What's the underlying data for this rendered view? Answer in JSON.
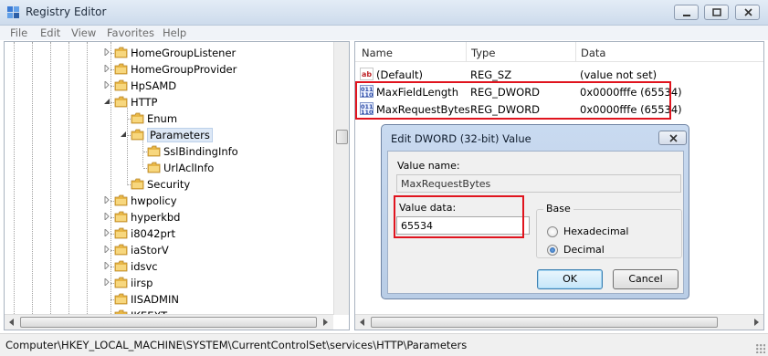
{
  "window": {
    "title": "Registry Editor"
  },
  "menu": [
    "File",
    "Edit",
    "View",
    "Favorites",
    "Help"
  ],
  "tree": {
    "items": [
      {
        "label": "HomeGroupListener",
        "level": 0,
        "expander": "collapsed"
      },
      {
        "label": "HomeGroupProvider",
        "level": 0,
        "expander": "collapsed"
      },
      {
        "label": "HpSAMD",
        "level": 0,
        "expander": "collapsed"
      },
      {
        "label": "HTTP",
        "level": 0,
        "expander": "expanded"
      },
      {
        "label": "Enum",
        "level": 1,
        "expander": "none"
      },
      {
        "label": "Parameters",
        "level": 1,
        "expander": "expanded",
        "selected": true
      },
      {
        "label": "SslBindingInfo",
        "level": 2,
        "expander": "none"
      },
      {
        "label": "UrlAclInfo",
        "level": 2,
        "expander": "none"
      },
      {
        "label": "Security",
        "level": 1,
        "expander": "none"
      },
      {
        "label": "hwpolicy",
        "level": 0,
        "expander": "collapsed"
      },
      {
        "label": "hyperkbd",
        "level": 0,
        "expander": "collapsed"
      },
      {
        "label": "i8042prt",
        "level": 0,
        "expander": "collapsed"
      },
      {
        "label": "iaStorV",
        "level": 0,
        "expander": "collapsed"
      },
      {
        "label": "idsvc",
        "level": 0,
        "expander": "collapsed"
      },
      {
        "label": "iirsp",
        "level": 0,
        "expander": "collapsed"
      },
      {
        "label": "IISADMIN",
        "level": 0,
        "expander": "none"
      },
      {
        "label": "IKEEXT",
        "level": 0,
        "expander": "none"
      }
    ]
  },
  "values": {
    "columns": {
      "name": "Name",
      "type": "Type",
      "data": "Data"
    },
    "rows": [
      {
        "icon": "string-value-icon",
        "glyph": "ab",
        "name": "(Default)",
        "type": "REG_SZ",
        "data": "(value not set)"
      },
      {
        "icon": "binary-value-icon",
        "glyph": "011 110",
        "name": "MaxFieldLength",
        "type": "REG_DWORD",
        "data": "0x0000fffe (65534)"
      },
      {
        "icon": "binary-value-icon",
        "glyph": "011 110",
        "name": "MaxRequestBytes",
        "type": "REG_DWORD",
        "data": "0x0000fffe (65534)"
      }
    ]
  },
  "dialog": {
    "title": "Edit DWORD (32-bit) Value",
    "value_name_label": "Value name:",
    "value_name": "MaxRequestBytes",
    "value_data_label": "Value data:",
    "value_data": "65534",
    "base_label": "Base",
    "hex_label": "Hexadecimal",
    "dec_label": "Decimal",
    "selected_base": "Decimal",
    "ok_label": "OK",
    "cancel_label": "Cancel"
  },
  "status": {
    "path": "Computer\\HKEY_LOCAL_MACHINE\\SYSTEM\\CurrentControlSet\\services\\HTTP\\Parameters"
  },
  "colors": {
    "highlight_box": "#e0141e",
    "selection": "#dde8f6",
    "folder": "#e8b746"
  }
}
